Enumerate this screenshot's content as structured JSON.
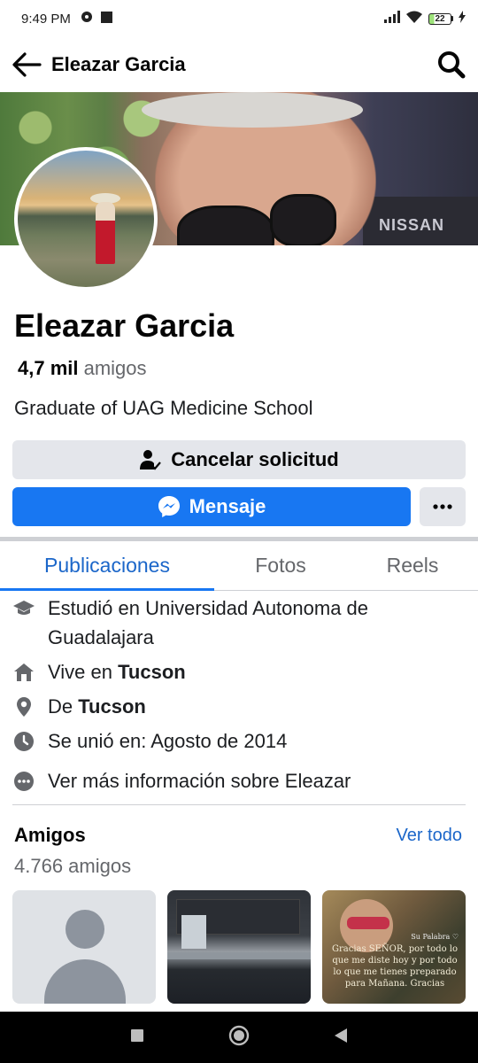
{
  "status_bar": {
    "time": "9:49 PM",
    "battery": "22"
  },
  "header": {
    "title": "Eleazar Garcia"
  },
  "cover": {
    "brand_text": "NISSAN"
  },
  "profile": {
    "name": "Eleazar Garcia",
    "friends_count": "4,7 mil",
    "friends_word": "amigos",
    "bio": "Graduate of UAG Medicine School"
  },
  "actions": {
    "cancel_label": "Cancelar solicitud",
    "message_label": "Mensaje",
    "more_icon": "more-horizontal-icon"
  },
  "tabs": [
    {
      "label": "Publicaciones",
      "active": true
    },
    {
      "label": "Fotos",
      "active": false
    },
    {
      "label": "Reels",
      "active": false
    }
  ],
  "details": {
    "studied_prefix": "Estudió en Universidad Autonoma de Guadalajara",
    "lives_prefix": "Vive en",
    "lives_city": "Tucson",
    "from_prefix": "De",
    "from_city": "Tucson",
    "joined": "Se unió en: Agosto de 2014",
    "more_info": "Ver más información sobre Eleazar"
  },
  "friends_section": {
    "title": "Amigos",
    "see_all": "Ver todo",
    "count": "4.766 amigos",
    "tile3_signature": "Su Palabra ♡",
    "tile3_quote": "Gracias SEÑOR, por todo lo que me diste hoy y por todo lo que me tienes preparado para Mañana. Gracias"
  },
  "colors": {
    "accent": "#1877f2",
    "link": "#1b66c9",
    "secondary_button": "#e4e6eb",
    "muted_text": "#65676b"
  }
}
